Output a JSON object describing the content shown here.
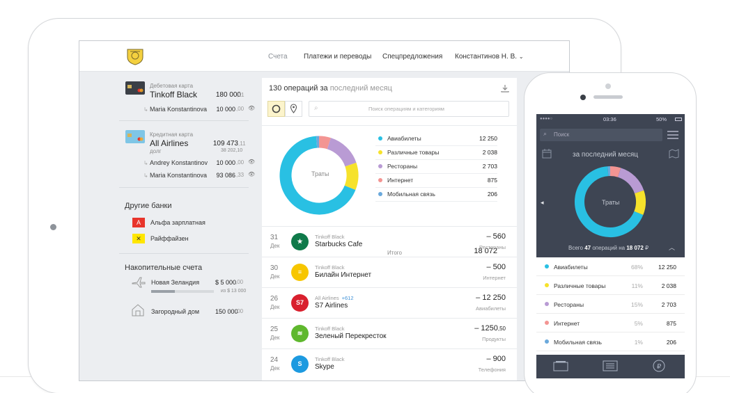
{
  "ipad": {
    "nav": [
      "Счета",
      "Платежи и переводы",
      "Спецпредложения",
      "Константинов Н. В."
    ],
    "debit": {
      "type": "Дебетовая карта",
      "name": "Tinkoff Black",
      "amount": "180 000",
      "amount_dec": ",11",
      "holder": "Maria Konstantinova",
      "holder_amount": "10 000",
      "holder_dec": ",00"
    },
    "credit": {
      "type": "Кредитная карта",
      "name": "All Airlines",
      "amount": "109 473",
      "amount_dec": ",11",
      "debt_label": "долг",
      "debt": "38 202,10",
      "holders": [
        {
          "name": "Andrey Konstantinov",
          "amount": "10 000",
          "dec": ",00"
        },
        {
          "name": "Maria Konstantinova",
          "amount": "93 086",
          "dec": ",33"
        }
      ]
    },
    "other_banks": {
      "title": "Другие банки",
      "items": [
        {
          "name": "Альфа зарплатная",
          "glyph": "А",
          "color": "#e8342b"
        },
        {
          "name": "Райффайзен",
          "glyph": "✕",
          "color": "#ffe600"
        }
      ]
    },
    "savings": {
      "title": "Накопительные счета",
      "items": [
        {
          "name": "Новая Зеландия",
          "amount": "$ 5 000",
          "dec": ",00",
          "goal": "из $ 13 000",
          "progress": 0.38
        },
        {
          "name": "Загородный дом",
          "amount": "150 000",
          "dec": ",00"
        }
      ]
    },
    "ops": {
      "title_count": "130 операций за",
      "title_period": "последний месяц",
      "search_placeholder": "Поиск операциям и категориям",
      "donut_label": "Траты"
    },
    "legend": [
      {
        "name": "Авиабилеты",
        "value": "12 250",
        "color": "#29c0e3"
      },
      {
        "name": "Различные товары",
        "value": "2 038",
        "color": "#f6e22b"
      },
      {
        "name": "Рестораны",
        "value": "2 703",
        "color": "#b99bd4"
      },
      {
        "name": "Интернет",
        "value": "875",
        "color": "#f39593"
      },
      {
        "name": "Мобильная связь",
        "value": "206",
        "color": "#6ba9dc"
      }
    ],
    "total_label": "Итого",
    "total": "18 072",
    "transactions": [
      {
        "day": "31",
        "month": "Дек",
        "source": "Tinkoff Black",
        "extra": "",
        "name": "Starbucks Cafe",
        "amount": "– 560",
        "category": "Рестораны",
        "color": "#0f7a4a",
        "glyph": "★"
      },
      {
        "day": "30",
        "month": "Дек",
        "source": "Tinkoff Black",
        "extra": "",
        "name": "Билайн Интернет",
        "amount": "– 500",
        "category": "Интернет",
        "color": "#f7c600",
        "glyph": "≡"
      },
      {
        "day": "26",
        "month": "Дек",
        "source": "All Airlines",
        "extra": "+612",
        "name": "S7 Airlines",
        "amount": "– 12 250",
        "category": "Авиабилеты",
        "color": "#d9202e",
        "glyph": "S7"
      },
      {
        "day": "25",
        "month": "Дек",
        "source": "Tinkoff Black",
        "extra": "",
        "name": "Зеленый Перекресток",
        "amount": "– 1250",
        "amount_dec": ",50",
        "category": "Продукты",
        "color": "#5fb82e",
        "glyph": "≋"
      },
      {
        "day": "24",
        "month": "Дек",
        "source": "Tinkoff Black",
        "extra": "",
        "name": "Skype",
        "amount": "– 900",
        "category": "Телефония",
        "color": "#1d9ae0",
        "glyph": "S"
      }
    ],
    "chart_data": {
      "type": "pie",
      "categories": [
        "Авиабилеты",
        "Различные товары",
        "Рестораны",
        "Интернет",
        "Мобильная связь"
      ],
      "values": [
        12250,
        2038,
        2703,
        875,
        206
      ],
      "title": "Траты"
    }
  },
  "phone": {
    "status": {
      "dots": "●●●●○",
      "time": "03:36",
      "battery": "50%"
    },
    "search_placeholder": "Поиск",
    "period": "за последний месяц",
    "donut_label": "Траты",
    "summary_pre": "Всего",
    "summary_count": "47",
    "summary_mid": "операций на",
    "summary_amount": "18 072",
    "summary_cur": "₽",
    "rows": [
      {
        "name": "Авиабилеты",
        "pct": "68%",
        "value": "12 250",
        "color": "#29c0e3"
      },
      {
        "name": "Различные товары",
        "pct": "11%",
        "value": "2 038",
        "color": "#f6e22b"
      },
      {
        "name": "Рестораны",
        "pct": "15%",
        "value": "2 703",
        "color": "#b99bd4"
      },
      {
        "name": "Интернет",
        "pct": "5%",
        "value": "875",
        "color": "#f39593"
      },
      {
        "name": "Мобильная связь",
        "pct": "1%",
        "value": "206",
        "color": "#6ba9dc"
      }
    ]
  }
}
